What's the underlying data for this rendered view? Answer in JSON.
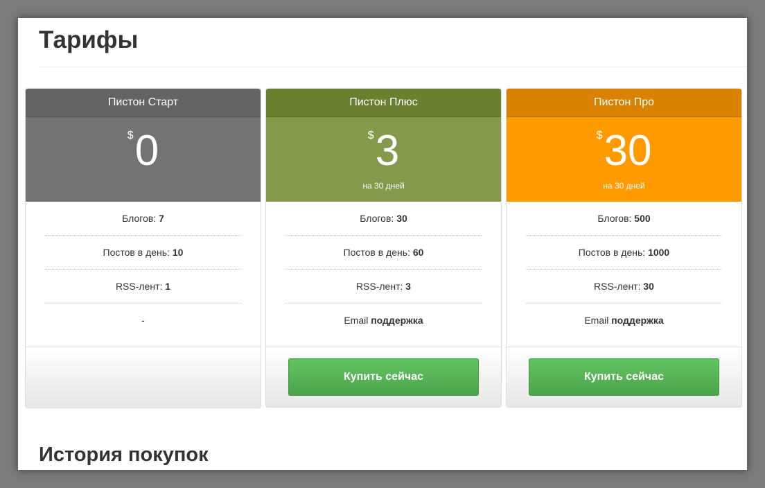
{
  "page": {
    "title": "Тарифы",
    "history_title": "История покупок"
  },
  "colors": {
    "start_header": "#646464",
    "start_price": "#737373",
    "plus_header": "#6b7f30",
    "plus_price": "#83994b",
    "pro_header": "#d98200",
    "pro_price": "#ff9a00",
    "button_green": "#5cb85c"
  },
  "plans": [
    {
      "name": "Пистон Старт",
      "currency": "$",
      "price": "0",
      "period": "",
      "features": [
        {
          "label": "Блогов: ",
          "value": "7"
        },
        {
          "label": "Постов в день: ",
          "value": "10"
        },
        {
          "label": "RSS-лент: ",
          "value": "1"
        },
        {
          "label": "-",
          "value": ""
        }
      ],
      "button": ""
    },
    {
      "name": "Пистон Плюс",
      "currency": "$",
      "price": "3",
      "period": "на 30 дней",
      "features": [
        {
          "label": "Блогов: ",
          "value": "30"
        },
        {
          "label": "Постов в день: ",
          "value": "60"
        },
        {
          "label": "RSS-лент: ",
          "value": "3"
        },
        {
          "label": "Email ",
          "value": "поддержка"
        }
      ],
      "button": "Купить сейчас"
    },
    {
      "name": "Пистон Про",
      "currency": "$",
      "price": "30",
      "period": "на 30 дней",
      "features": [
        {
          "label": "Блогов: ",
          "value": "500"
        },
        {
          "label": "Постов в день: ",
          "value": "1000"
        },
        {
          "label": "RSS-лент: ",
          "value": "30"
        },
        {
          "label": "Email ",
          "value": "поддержка"
        }
      ],
      "button": "Купить сейчас"
    }
  ]
}
